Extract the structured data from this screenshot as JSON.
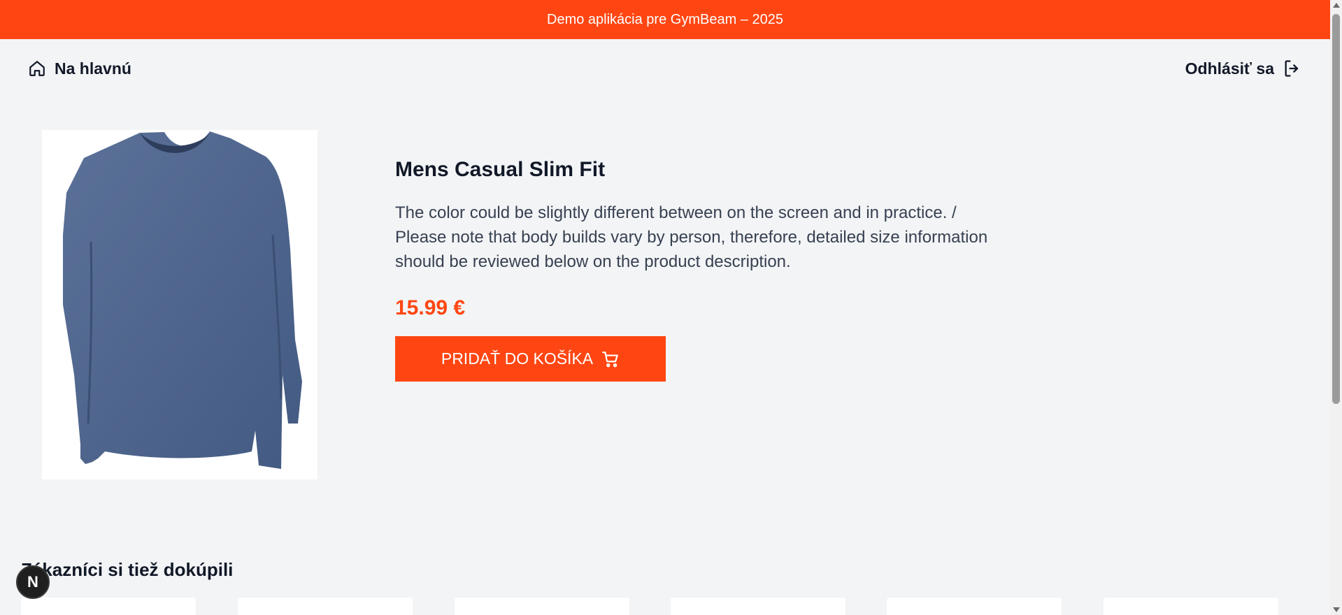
{
  "banner": {
    "text": "Demo aplikácia pre GymBeam – 2025"
  },
  "nav": {
    "home_label": "Na hlavnú",
    "home_icon": "home-icon",
    "logout_label": "Odhlásiť sa",
    "logout_icon": "logout-icon"
  },
  "product": {
    "title": "Mens Casual Slim Fit",
    "description": "The color could be slightly different between on the screen and in practice. / Please note that body builds vary by person, therefore, detailed size information should be reviewed below on the product description.",
    "price": "15.99 €",
    "add_to_cart_label": "PRIDAŤ DO KOŠÍKA",
    "cart_icon": "cart-icon",
    "image_icon": "long-sleeve-tshirt-image"
  },
  "related": {
    "title": "Zákazníci si tiež dokúpili",
    "cards": [
      {
        "name": "related-product-1"
      },
      {
        "name": "related-product-2"
      },
      {
        "name": "related-product-3"
      },
      {
        "name": "related-product-4"
      },
      {
        "name": "related-product-5"
      },
      {
        "name": "related-product-6"
      }
    ]
  },
  "devtools": {
    "badge_letter": "N"
  },
  "colors": {
    "accent": "#ff4612",
    "background": "#f3f4f6",
    "text": "#111827"
  }
}
